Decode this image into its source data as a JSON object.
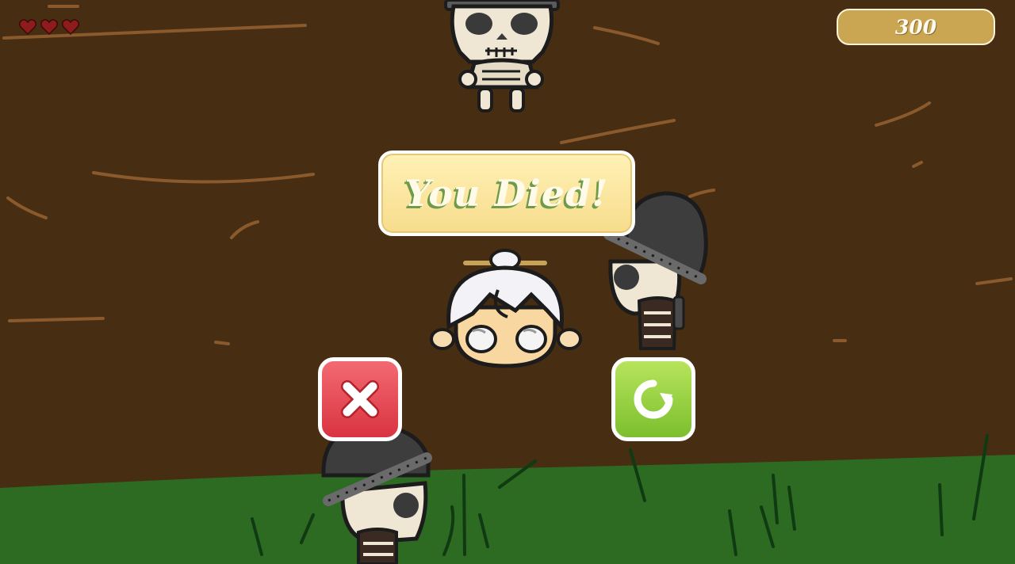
{
  "hud": {
    "lives": 3,
    "heart_icon": "heart-icon",
    "score": "300"
  },
  "dialog": {
    "title": "You Died!",
    "quit_icon": "close-icon",
    "restart_icon": "restart-icon"
  },
  "colors": {
    "dirt": "#472d12",
    "grass": "#2d6a22",
    "banner": "#f7dc8c",
    "quit_button": "#e34650",
    "restart_button": "#9ad146",
    "score_panel": "#caa653"
  }
}
